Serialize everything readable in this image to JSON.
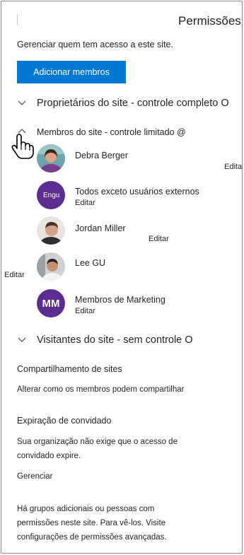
{
  "panel": {
    "title": "Permissões",
    "subtitle": "Gerenciar quem tem acesso a este site.",
    "add_members_label": "Adicionar membros"
  },
  "sections": {
    "owners": "Proprietários do site - controle completo O",
    "members": "Membros do site - controle limitado @",
    "visitors": "Visitantes do site - sem controle O"
  },
  "members_list": [
    {
      "name": "Debra Berger",
      "role": "Editar"
    },
    {
      "name": "Todos exceto usuários externos",
      "role": "Editar",
      "initials": "Engu"
    },
    {
      "name": "Jordan Miller",
      "role": "Editar"
    },
    {
      "name": "Lee GU",
      "role": "Editar"
    },
    {
      "name": "Membros de Marketing",
      "role": "Editar",
      "initials": "MM"
    }
  ],
  "sharing": {
    "heading": "Compartilhamento de sites",
    "link": "Alterar como os membros podem compartilhar"
  },
  "guest_expiration": {
    "heading": "Expiração de convidado",
    "text_line1": "Sua organização não exige que o acesso de",
    "text_line2": "convidado expire.",
    "manage": "Gerenciar"
  },
  "footer": {
    "line1": "Há grupos adicionais ou pessoas com",
    "line2": "permissões neste site. Para vê-los. Visite",
    "line3": "configurações de permissões avançadas."
  },
  "colors": {
    "accent": "#0078d4",
    "group_avatar": "#5c2d91"
  }
}
